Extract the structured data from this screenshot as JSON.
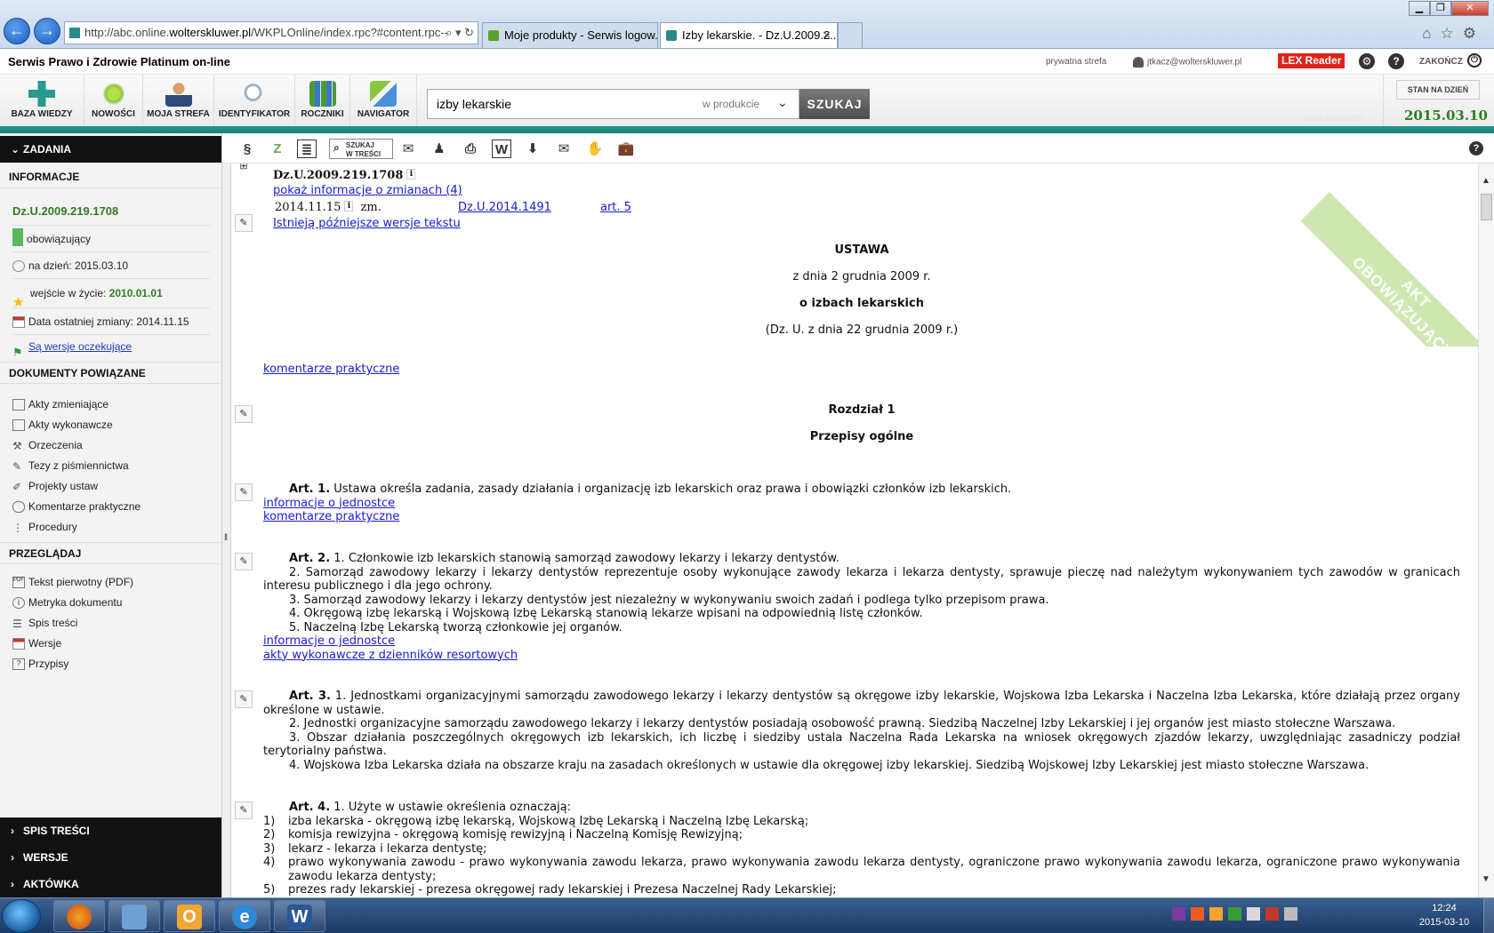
{
  "browser": {
    "url_prefix": "http://abc.online.",
    "url_domain": "wolterskluwer.pl",
    "url_suffix": "/WKPLOnline/index.rpc?#content.rpc--",
    "tabs": [
      {
        "label": "Moje produkty - Serwis logow...",
        "active": false
      },
      {
        "label": "Izby lekarskie. - Dz.U.2009.2...",
        "active": true
      }
    ],
    "tab_close": "✕"
  },
  "site": {
    "title": "Serwis Prawo i Zdrowie Platinum on-line",
    "private_zone": "prywatna strefa",
    "user_email": "jtkacz@wolterskluwer.pl",
    "lex_reader": "LEX Reader",
    "logout": "ZAKOŃCZ",
    "watermark": "www-online-06"
  },
  "main_toolbar": {
    "items": [
      {
        "label": "BAZA WIEDZY",
        "color": "#2a9a8c"
      },
      {
        "label": "NOWOŚCI",
        "color": "#8cc63f"
      },
      {
        "label": "MOJA STREFA",
        "color": "#b5651d"
      },
      {
        "label": "IDENTYFIKATOR",
        "color": "#9ab0c8"
      },
      {
        "label": "ROCZNIKI",
        "color": "#4b9a3a"
      },
      {
        "label": "NAVIGATOR",
        "color": "#4a90d9"
      }
    ],
    "search_value": "izby lekarskie",
    "search_scope": "w produkcie",
    "search_button": "SZUKAJ",
    "date_button": "STAN NA DZIEŃ",
    "date_value": "2015.03.10"
  },
  "sidebar": {
    "zadania": "ZADANIA",
    "informacje": "INFORMACJE",
    "doc_id": "Dz.U.2009.219.1708",
    "status": "obowiązujący",
    "as_of_label": "na dzień: 2015.03.10",
    "in_force_label": "wejście w życie:",
    "in_force_date": "2010.01.01",
    "last_change": "Data ostatniej zmiany: 2014.11.15",
    "pending_versions": "Są wersje oczekujące",
    "related_header": "DOKUMENTY POWIĄZANE",
    "related": [
      "Akty zmieniające",
      "Akty wykonawcze",
      "Orzeczenia",
      "Tezy z piśmiennictwa",
      "Projekty ustaw",
      "Komentarze praktyczne",
      "Procedury"
    ],
    "browse_header": "PRZEGLĄDAJ",
    "browse": [
      "Tekst pierwotny (PDF)",
      "Metryka dokumentu",
      "Spis treści",
      "Wersje",
      "Przypisy"
    ],
    "bottom": [
      "SPIS TREŚCI",
      "WERSJE",
      "AKTÓWKA"
    ]
  },
  "content_toolbar": {
    "section_symbol": "§",
    "szukaj_line1": "SZUKAJ",
    "szukaj_line2": "W TREŚCI",
    "help": "?"
  },
  "document": {
    "ribbon_line1": "AKT",
    "ribbon_line2": "OBOWIĄZUJĄCY",
    "id": "Dz.U.2009.219.1708",
    "show_changes": "pokaż informacje o zmianach (4)",
    "change_date": "2014.11.15",
    "change_type": "zm.",
    "change_ref": "Dz.U.2014.1491",
    "change_art": "art. 5",
    "later_versions": "Istnieją późniejsze wersje tekstu",
    "act_type": "USTAWA",
    "act_date": "z dnia 2 grudnia 2009 r.",
    "act_title": "o izbach lekarskich",
    "act_source": "(Dz. U. z dnia 22 grudnia 2009 r.)",
    "commentary": "komentarze praktyczne",
    "chapter": "Rozdział 1",
    "chapter_title": "Przepisy ogólne",
    "art1_label": "Art. 1.",
    "art1_text": "Ustawa określa zadania, zasady działania i organizację izb lekarskich oraz prawa i obowiązki członków izb lekarskich.",
    "link_info_unit": "informacje o jednostce",
    "link_commentary": "komentarze praktyczne",
    "art2_label": "Art. 2.",
    "art2_p1": "1. Członkowie izb lekarskich stanowią samorząd zawodowy lekarzy i lekarzy dentystów.",
    "art2_p2": "2. Samorząd zawodowy lekarzy i lekarzy dentystów reprezentuje osoby wykonujące zawody lekarza i lekarza dentysty, sprawuje pieczę nad należytym wykonywaniem tych zawodów w granicach interesu publicznego i dla jego ochrony.",
    "art2_p3": "3. Samorząd zawodowy lekarzy i lekarzy dentystów jest niezależny w wykonywaniu swoich zadań i podlega tylko przepisom prawa.",
    "art2_p4": "4. Okręgową izbę lekarską i Wojskową Izbę Lekarską stanowią lekarze wpisani na odpowiednią listę członków.",
    "art2_p5": "5. Naczelną Izbę Lekarską tworzą członkowie jej organów.",
    "link_info_unit2": "informacje o jednostce",
    "link_exec_acts": "akty wykonawcze z dzienników resortowych",
    "art3_label": "Art. 3.",
    "art3_p1": "1. Jednostkami organizacyjnymi samorządu zawodowego lekarzy i lekarzy dentystów są okręgowe izby lekarskie, Wojskowa Izba Lekarska i Naczelna Izba Lekarska, które działają przez organy określone w ustawie.",
    "art3_p2": "2. Jednostki organizacyjne samorządu zawodowego lekarzy i lekarzy dentystów posiadają osobowość prawną. Siedzibą Naczelnej Izby Lekarskiej i jej organów jest miasto stołeczne Warszawa.",
    "art3_p3": "3. Obszar działania poszczególnych okręgowych izb lekarskich, ich liczbę i siedziby ustala Naczelna Rada Lekarska na wniosek okręgowych zjazdów lekarzy, uwzględniając zasadniczy podział terytorialny państwa.",
    "art3_p4": "4. Wojskowa Izba Lekarska działa na obszarze kraju na zasadach określonych w ustawie dla okręgowej izby lekarskiej. Siedzibą Wojskowej Izby Lekarskiej jest miasto stołeczne Warszawa.",
    "art4_label": "Art. 4.",
    "art4_intro": "1. Użyte w ustawie określenia oznaczają:",
    "art4_items": [
      {
        "num": "1)",
        "text": "izba lekarska - okręgową izbę lekarską, Wojskową Izbę Lekarską i Naczelną Izbę Lekarską;"
      },
      {
        "num": "2)",
        "text": "komisja rewizyjna - okręgową komisję rewizyjną i Naczelną Komisję Rewizyjną;"
      },
      {
        "num": "3)",
        "text": "lekarz - lekarza i lekarza dentystę;"
      },
      {
        "num": "4)",
        "text": "prawo wykonywania zawodu - prawo wykonywania zawodu lekarza, prawo wykonywania zawodu lekarza dentysty, ograniczone prawo wykonywania zawodu lekarza, ograniczone prawo wykonywania zawodu lekarza dentysty;"
      },
      {
        "num": "5)",
        "text": "prezes rady lekarskiej - prezesa okręgowej rady lekarskiej i Prezesa Naczelnej Rady Lekarskiej;"
      }
    ]
  },
  "taskbar": {
    "time": "12:24",
    "date": "2015-03-10"
  }
}
